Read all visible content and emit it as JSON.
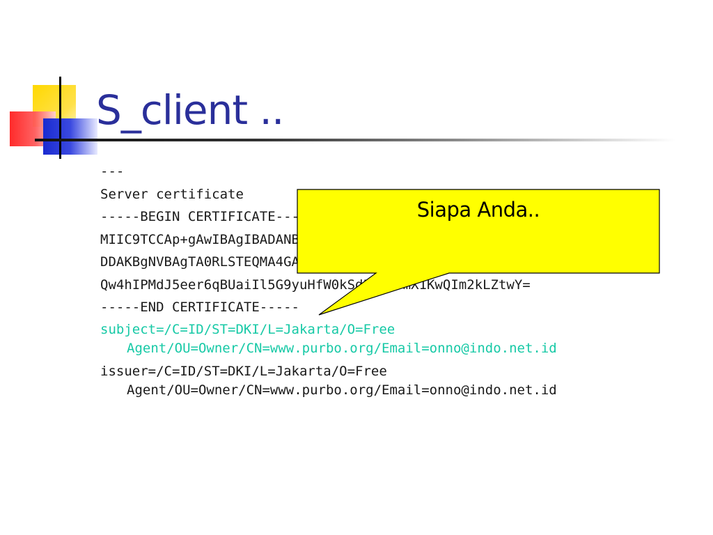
{
  "slide": {
    "title": "S_client ..",
    "lines": [
      "---",
      "Server certificate",
      "-----BEGIN CERTIFICATE-----",
      "MIIC9TCCAp+gAwIBAgIBADANBgkqhkiG9w0BAQQFADCBjzELMAkGA1UEBhMCSURCSU",
      "DDAKBgNVBAgTA0RLSTEQMA4GA1UEBxMHSmFrYXJ0YTETMBEGA1UEChMKRnJlZSBlZS",
      "Qw4hIPMdJ5eer6qBUaiIl5G9yuHfW0kSd58OVsmX1KwQIm2kLZtwY=",
      "-----END CERTIFICATE-----"
    ],
    "subject": {
      "line1": "subject=/C=ID/ST=DKI/L=Jakarta/O=Free",
      "line2": "Agent/OU=Owner/CN=www.purbo.org/Email=onno@indo.net.id"
    },
    "issuer": {
      "line1": "issuer=/C=ID/ST=DKI/L=Jakarta/O=Free",
      "line2": "Agent/OU=Owner/CN=www.purbo.org/Email=onno@indo.net.id"
    },
    "callout": "Siapa Anda.."
  },
  "colors": {
    "title": "#2a2f9a",
    "subject": "#17c9a6",
    "callout_fill": "#ffff00"
  }
}
